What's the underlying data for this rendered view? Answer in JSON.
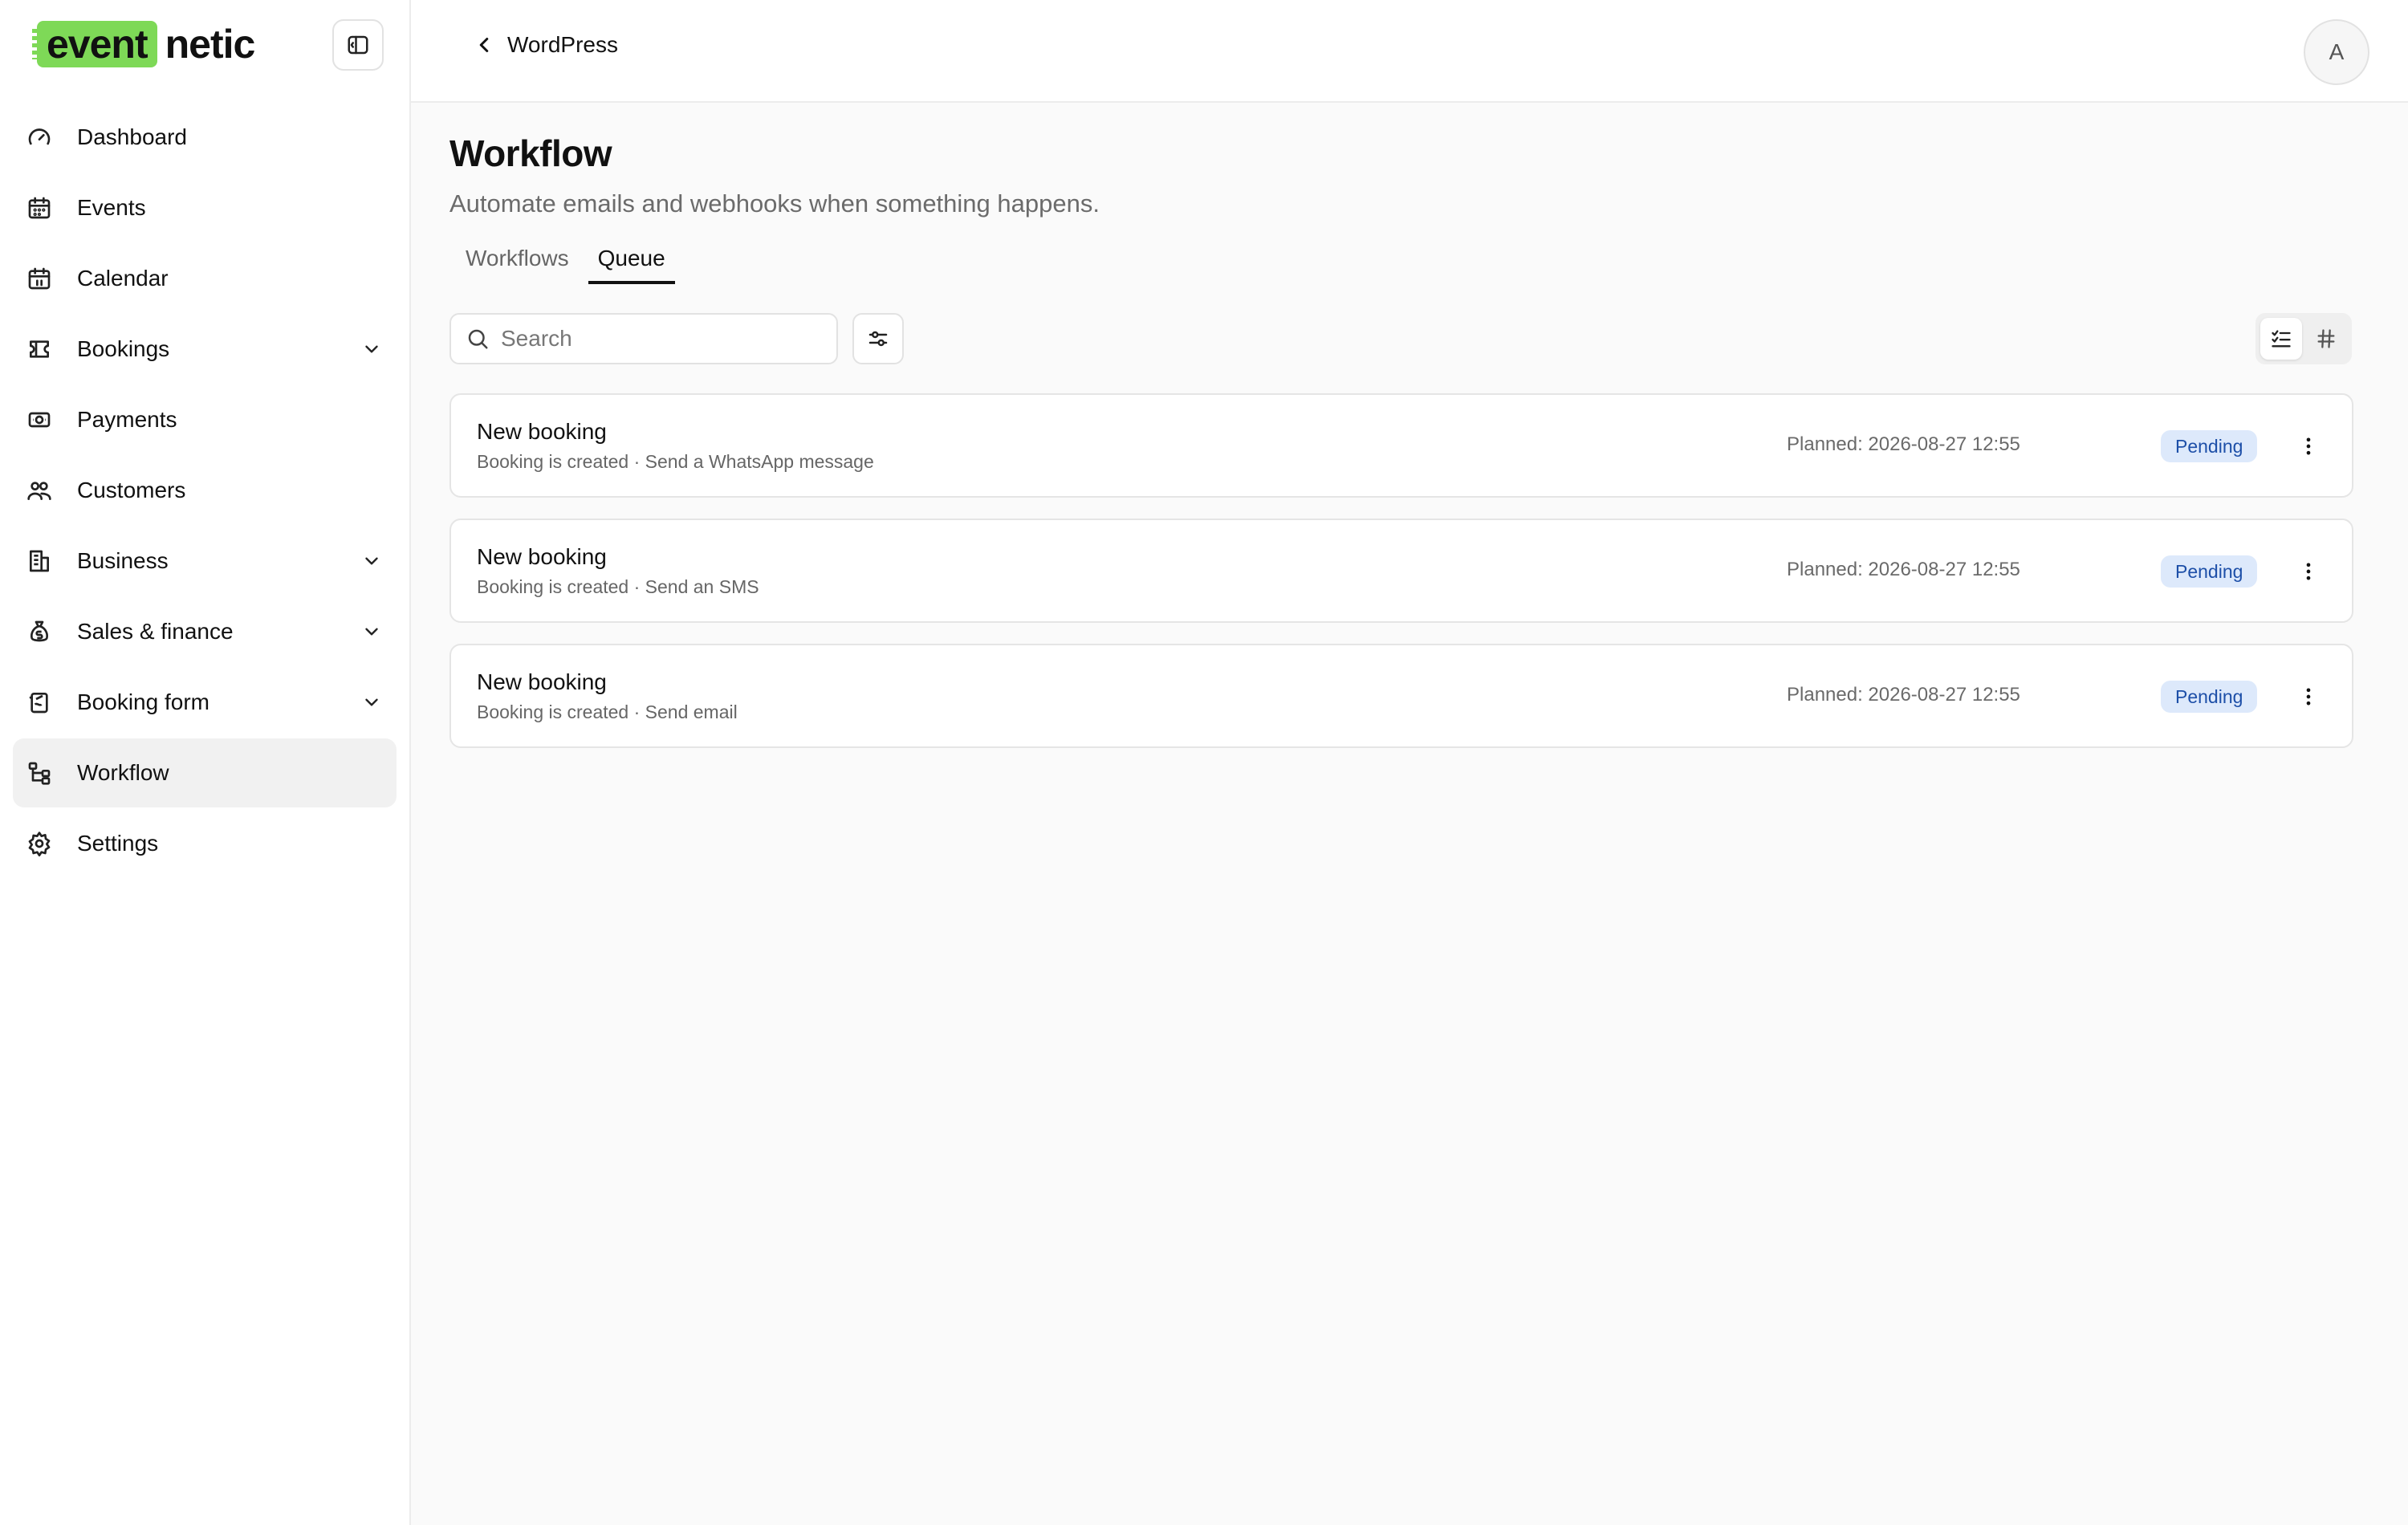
{
  "brand": {
    "logo_highlight": "event",
    "logo_rest": "netic",
    "accent": "#7ed957"
  },
  "sidebar": {
    "items": [
      {
        "label": "Dashboard",
        "icon": "gauge-icon",
        "expandable": false
      },
      {
        "label": "Events",
        "icon": "calendar-grid-icon",
        "expandable": false
      },
      {
        "label": "Calendar",
        "icon": "calendar-icon",
        "expandable": false
      },
      {
        "label": "Bookings",
        "icon": "ticket-icon",
        "expandable": true
      },
      {
        "label": "Payments",
        "icon": "banknote-icon",
        "expandable": false
      },
      {
        "label": "Customers",
        "icon": "users-icon",
        "expandable": false
      },
      {
        "label": "Business",
        "icon": "building-icon",
        "expandable": true
      },
      {
        "label": "Sales & finance",
        "icon": "money-bag-icon",
        "expandable": true
      },
      {
        "label": "Booking form",
        "icon": "form-icon",
        "expandable": true
      },
      {
        "label": "Workflow",
        "icon": "workflow-icon",
        "expandable": false,
        "active": true
      },
      {
        "label": "Settings",
        "icon": "gear-icon",
        "expandable": false
      }
    ]
  },
  "header": {
    "breadcrumb": "WordPress",
    "avatar_initial": "A"
  },
  "page": {
    "title": "Workflow",
    "subtitle": "Automate emails and webhooks when something happens.",
    "tabs": [
      {
        "label": "Workflows",
        "active": false
      },
      {
        "label": "Queue",
        "active": true
      }
    ]
  },
  "search": {
    "placeholder": "Search",
    "value": ""
  },
  "queue": [
    {
      "title": "New booking",
      "trigger": "Booking is created",
      "action": "Send a WhatsApp message",
      "meta": "Booking is created · Send a WhatsApp message",
      "planned": "Planned: 2026-08-27 12:55",
      "status": "Pending"
    },
    {
      "title": "New booking",
      "trigger": "Booking is created",
      "action": "Send an SMS",
      "meta": "Booking is created · Send an SMS",
      "planned": "Planned: 2026-08-27 12:55",
      "status": "Pending"
    },
    {
      "title": "New booking",
      "trigger": "Booking is created",
      "action": "Send email",
      "meta": "Booking is created · Send email",
      "planned": "Planned: 2026-08-27 12:55",
      "status": "Pending"
    }
  ],
  "colors": {
    "badge_bg": "#dde9fb",
    "badge_text": "#1d4fa8",
    "active_nav_bg": "#f1f1f1"
  }
}
